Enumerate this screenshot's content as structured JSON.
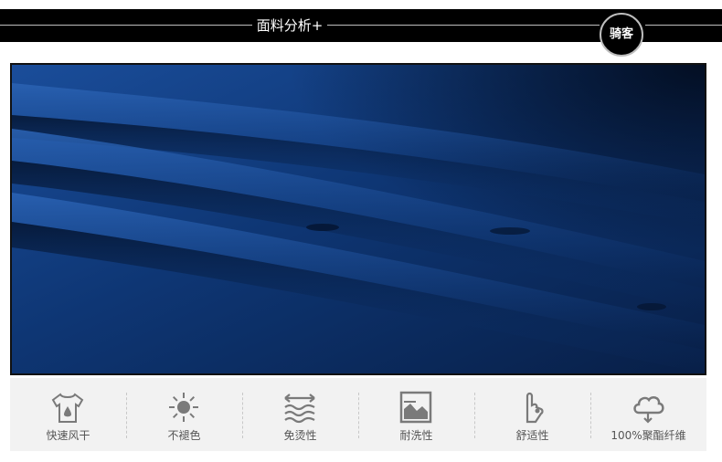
{
  "header": {
    "section_title": "面料分析+",
    "brand": "骑客"
  },
  "photo": {
    "colors": {
      "fabric": "#0e3674",
      "fabric_light": "#1a4d9a",
      "fabric_dark": "#081f47"
    }
  },
  "features": [
    {
      "icon": "tshirt-drop-icon",
      "label": "快速风干"
    },
    {
      "icon": "sun-icon",
      "label": "不褪色"
    },
    {
      "icon": "waves-arrows-icon",
      "label": "免烫性"
    },
    {
      "icon": "mountain-picture-icon",
      "label": "耐洗性"
    },
    {
      "icon": "hand-icon",
      "label": "舒适性"
    },
    {
      "icon": "cloud-icon",
      "label": "100%聚酯纤维"
    }
  ],
  "colors": {
    "header_bg": "#000000",
    "strip_bg": "#f2f2f2",
    "icon": "#7a7a7a"
  }
}
